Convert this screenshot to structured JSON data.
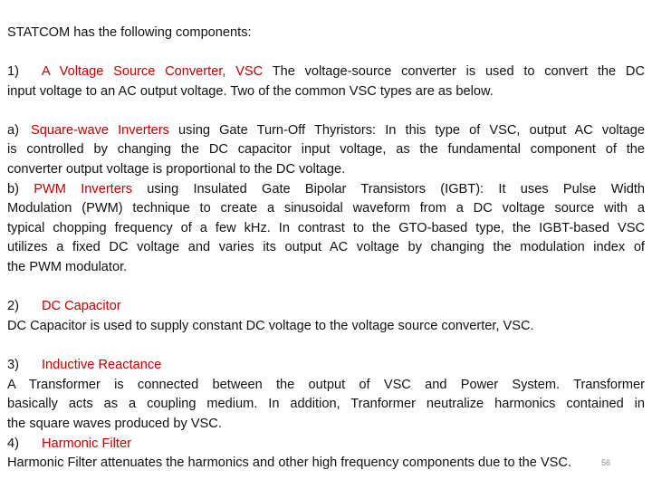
{
  "slide": {
    "heading": "STATCOM has the following components:",
    "sections": {
      "vsc": {
        "number": "1)",
        "title": "A Voltage Source Converter, VSC",
        "line1_rest": " The voltage-source converter is used to convert the DC",
        "line2": "input voltage to an AC output voltage. Two of the common VSC types are as below."
      },
      "square": {
        "label": "a)",
        "title": "Square-wave Inverters",
        "line1_rest": " using Gate Turn-Off Thyristors: In this type of VSC, output AC voltage",
        "line2": "is controlled by changing the DC capacitor input voltage, as the fundamental component of the",
        "line3": "converter output voltage is proportional to the DC voltage."
      },
      "pwm": {
        "label": "b)",
        "title": "PWM Inverters",
        "line1_rest": " using Insulated Gate Bipolar Transistors (IGBT): It uses Pulse Width",
        "line2": "Modulation (PWM) technique to create a sinusoidal waveform from a DC voltage source with a",
        "line3": "typical chopping frequency of a few kHz. In contrast to the GTO-based type, the IGBT-based VSC",
        "line4": "utilizes a fixed DC voltage and varies its output AC voltage by changing the modulation index of",
        "line5": "the PWM modulator."
      },
      "capacitor": {
        "number": "2)",
        "title": "DC Capacitor",
        "body": "DC Capacitor is used to supply constant DC voltage to the voltage source converter, VSC."
      },
      "reactance": {
        "number": "3)",
        "title": "Inductive Reactance",
        "line1": "A Transformer is connected between the output of VSC and Power System. Transformer",
        "line2": "basically acts as a coupling medium. In addition, Tranformer neutralize harmonics contained in",
        "line3": "the square waves produced by VSC."
      },
      "filter": {
        "number": "4)",
        "title": "Harmonic Filter",
        "body": "Harmonic Filter attenuates the harmonics and other high frequency components due to the VSC."
      }
    },
    "slide_number": "56"
  },
  "colors": {
    "accent_red": "#c00000",
    "text": "#111111"
  }
}
